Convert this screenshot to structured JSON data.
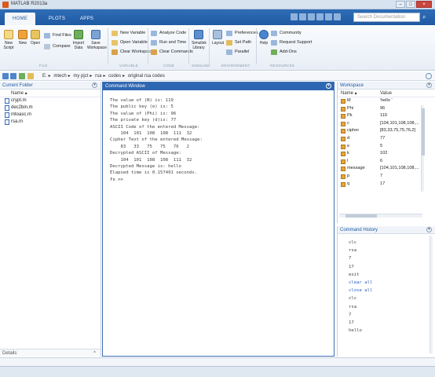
{
  "window": {
    "title": "MATLAB R2013a"
  },
  "tabs": [
    {
      "label": "HOME"
    },
    {
      "label": "PLOTS"
    },
    {
      "label": "APPS"
    }
  ],
  "search": {
    "placeholder": "Search Documentation"
  },
  "ribbon": {
    "new_script": "New Script",
    "new": "New",
    "open": "Open",
    "find_files": "Find Files",
    "compare": "Compare",
    "import_data": "Import Data",
    "save_workspace": "Save Workspace",
    "new_variable": "New Variable",
    "open_variable": "Open Variable",
    "clear_workspace": "Clear Workspace",
    "analyze_code": "Analyze Code",
    "run_and_time": "Run and Time",
    "clear_commands": "Clear Commands",
    "simulink_library": "Simulink Library",
    "layout": "Layout",
    "preferences": "Preferences",
    "set_path": "Set Path",
    "parallel": "Parallel",
    "help": "Help",
    "community": "Community",
    "request_support": "Request Support",
    "add_ons": "Add-Ons",
    "sec_file": "FILE",
    "sec_variable": "VARIABLE",
    "sec_code": "CODE",
    "sec_simulink": "SIMULINK",
    "sec_environment": "ENVIRONMENT",
    "sec_resources": "RESOURCES"
  },
  "address": {
    "crumbs": [
      "E:",
      "mtech",
      "my pjct",
      "rsa",
      "codes",
      "original rsa codes"
    ]
  },
  "current_folder": {
    "title": "Current Folder",
    "col_name": "Name",
    "files": [
      "crypt.m",
      "dec2bin.m",
      "mtoasc.m",
      "rsa.m"
    ],
    "details": "Details"
  },
  "command_window": {
    "title": "Command Window",
    "lines": [
      "The value of (N) is: 119",
      "The public key (e) is: 5",
      "The value of (Phi) is: 96",
      "The private key (d)is: 77",
      "ASCII Code of the entered Message:",
      "    104  101  108  108  111  32",
      "",
      "Cipher Text of the entered Message:",
      "    83   33   75   75   76   2",
      "",
      "Decrypted ASCII of Message:",
      "    104  101  108  108  111  32",
      "",
      "Decrypted Message is: hello",
      "Elapsed time is 0.157491 seconds.",
      "fx >>"
    ]
  },
  "workspace": {
    "title": "Workspace",
    "col_name": "Name",
    "col_value": "Value",
    "rows": [
      {
        "name": "M",
        "value": "'hello '"
      },
      {
        "name": "Phi",
        "value": "96"
      },
      {
        "name": "Pk",
        "value": "119"
      },
      {
        "name": "c",
        "value": "[104,101,108,108,..."
      },
      {
        "name": "cipher",
        "value": "[83,33,75,75,76,2]"
      },
      {
        "name": "d",
        "value": "77"
      },
      {
        "name": "e",
        "value": "5"
      },
      {
        "name": "k",
        "value": "102"
      },
      {
        "name": "l",
        "value": "6"
      },
      {
        "name": "message",
        "value": "[104,101,108,108,..."
      },
      {
        "name": "p",
        "value": "7"
      },
      {
        "name": "q",
        "value": "17"
      }
    ]
  },
  "command_history": {
    "title": "Command History",
    "items": [
      {
        "text": "clc",
        "kind": "plain"
      },
      {
        "text": "rsa",
        "kind": "plain"
      },
      {
        "text": "7",
        "kind": "plain"
      },
      {
        "text": "17",
        "kind": "plain"
      },
      {
        "text": "exit",
        "kind": "plain"
      },
      {
        "text": "clear all",
        "kind": "kw"
      },
      {
        "text": "close all",
        "kind": "kw"
      },
      {
        "text": "clc",
        "kind": "plain"
      },
      {
        "text": "rsa",
        "kind": "plain"
      },
      {
        "text": "7",
        "kind": "plain"
      },
      {
        "text": "17",
        "kind": "plain"
      },
      {
        "text": "hello",
        "kind": "plain"
      }
    ]
  }
}
